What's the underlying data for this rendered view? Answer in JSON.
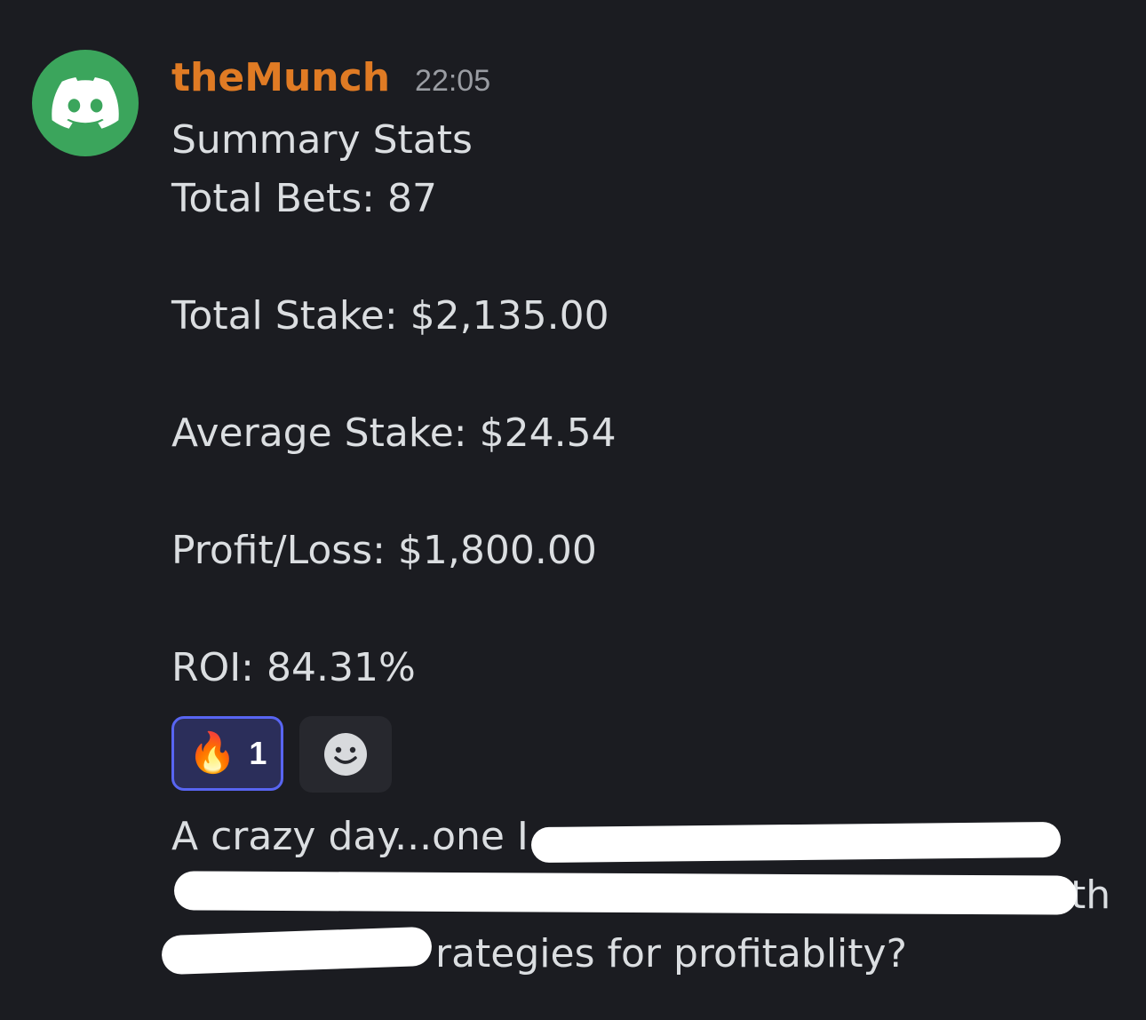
{
  "message": {
    "author": "theMunch",
    "time": "22:05",
    "lines": [
      "Summary Stats",
      "Total Bets: 87",
      "Total Stake: $2,135.00",
      "Average Stake: $24.54",
      "Profit/Loss: $1,800.00",
      "ROI: 84.31%"
    ],
    "reaction": {
      "emoji": "🔥",
      "count": "1"
    },
    "followup": {
      "line1_visible": "A crazy day...one I a",
      "line2_visible_end": "th",
      "line3_visible": "rategies for profitablity?"
    }
  },
  "colors": {
    "background": "#1b1c21",
    "username": "#e07b24",
    "avatar": "#3ba55c",
    "reaction_border": "#5865f2"
  },
  "icons": {
    "avatar": "discord-logo-icon",
    "reaction": "fire-emoji-icon",
    "add_reaction": "smiley-face-icon"
  }
}
